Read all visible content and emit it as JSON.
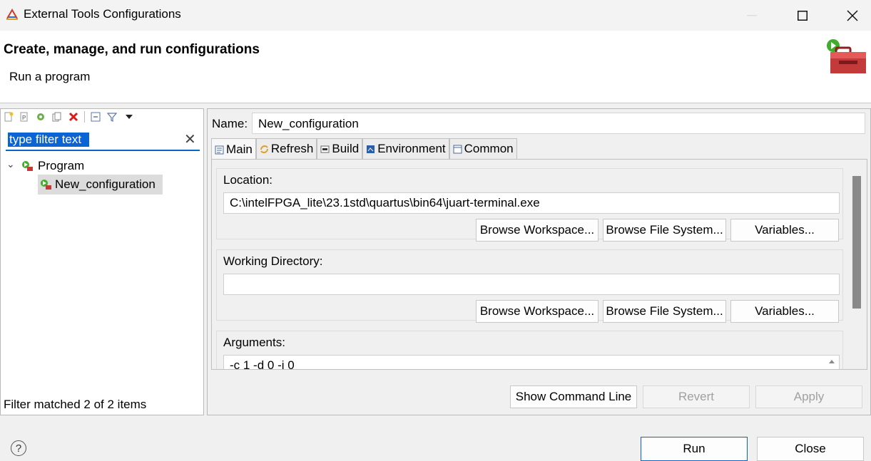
{
  "window": {
    "title": "External Tools Configurations",
    "controls": {
      "minimize": "—",
      "maximize": "☐",
      "close": "✕"
    }
  },
  "header": {
    "title": "Create, manage, and run configurations",
    "subtitle": "Run a program",
    "icon": "toolbox-run-icon"
  },
  "left_panel": {
    "toolbar": [
      "new-config-icon",
      "new-prototype-icon",
      "export-icon",
      "duplicate-icon",
      "delete-icon",
      "collapse-all-icon",
      "filter-icon",
      "view-menu-icon"
    ],
    "filter": {
      "value": "type filter text",
      "clear": "✕"
    },
    "tree": {
      "expander": "⌄",
      "category": "Program",
      "items": [
        {
          "label": "New_configuration",
          "selected": true
        }
      ]
    },
    "status": "Filter matched 2 of 2 items"
  },
  "right_panel": {
    "name_label": "Name:",
    "name_value": "New_configuration",
    "tabs": [
      {
        "label": "Main",
        "icon": "main-tab-icon",
        "active": true
      },
      {
        "label": "Refresh",
        "icon": "refresh-tab-icon"
      },
      {
        "label": "Build",
        "icon": "build-tab-icon"
      },
      {
        "label": "Environment",
        "icon": "environment-tab-icon"
      },
      {
        "label": "Common",
        "icon": "common-tab-icon"
      }
    ],
    "location": {
      "label": "Location:",
      "value": "C:\\intelFPGA_lite\\23.1std\\quartus\\bin64\\juart-terminal.exe",
      "buttons": [
        "Browse Workspace...",
        "Browse File System...",
        "Variables..."
      ]
    },
    "working_directory": {
      "label": "Working Directory:",
      "value": "",
      "buttons": [
        "Browse Workspace...",
        "Browse File System...",
        "Variables..."
      ]
    },
    "arguments": {
      "label": "Arguments:",
      "value": "-c 1 -d 0 -i 0"
    },
    "actions": {
      "show_command_line": "Show Command Line",
      "revert": "Revert",
      "apply": "Apply"
    }
  },
  "footer": {
    "help": "?",
    "run": "Run",
    "close": "Close"
  },
  "colors": {
    "selection": "#0a64d6",
    "tree_selected": "#dcdcdc"
  }
}
